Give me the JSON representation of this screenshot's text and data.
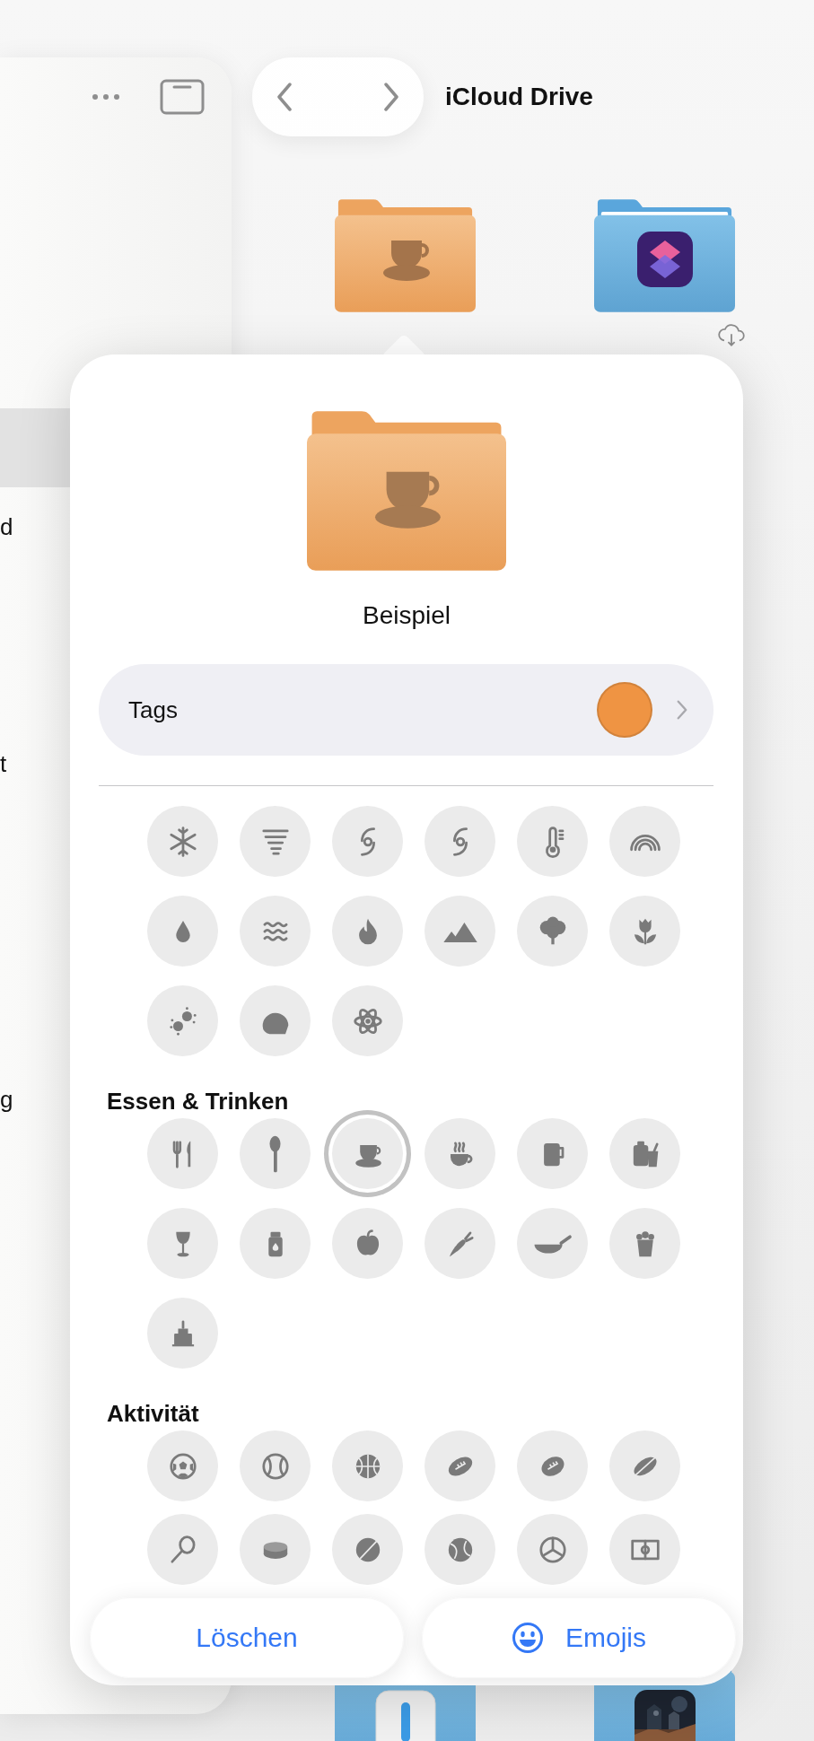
{
  "sidebar": {
    "items": [
      {
        "selected": true
      },
      {
        "label": "d",
        "selected": false
      },
      {
        "label": "t",
        "selected": false
      },
      {
        "label": "g",
        "selected": false
      }
    ]
  },
  "title": "iCloud Drive",
  "popover": {
    "name": "Beispiel",
    "tags": {
      "label": "Tags",
      "color": "#ef9443"
    },
    "sections": [
      {
        "symbols": [
          {
            "selected": false
          },
          {
            "selected": false
          },
          {
            "selected": false
          },
          {
            "selected": false
          },
          {
            "selected": false
          },
          {
            "selected": false
          },
          {
            "selected": false
          },
          {
            "selected": false
          },
          {
            "selected": false
          },
          {
            "selected": false
          },
          {
            "selected": false
          },
          {
            "selected": false
          },
          {
            "selected": false
          },
          {
            "selected": false
          },
          {
            "selected": false
          }
        ]
      },
      {
        "title": "Essen & Trinken",
        "symbols": [
          {
            "selected": false
          },
          {
            "selected": false
          },
          {
            "selected": true
          },
          {
            "selected": false
          },
          {
            "selected": false
          },
          {
            "selected": false
          },
          {
            "selected": false
          },
          {
            "selected": false
          },
          {
            "selected": false
          },
          {
            "selected": false
          },
          {
            "selected": false
          },
          {
            "selected": false
          },
          {
            "selected": false
          }
        ]
      },
      {
        "title": "Aktivität",
        "symbols": [
          {
            "selected": false
          },
          {
            "selected": false
          },
          {
            "selected": false
          },
          {
            "selected": false
          },
          {
            "selected": false
          },
          {
            "selected": false
          },
          {
            "selected": false
          },
          {
            "selected": false
          },
          {
            "selected": false
          },
          {
            "selected": false
          },
          {
            "selected": false
          },
          {
            "selected": false
          }
        ]
      }
    ],
    "buttons": [
      {
        "label": "Löschen",
        "kind": "plain"
      },
      {
        "label": "Emojis",
        "kind": "emoji"
      }
    ]
  }
}
